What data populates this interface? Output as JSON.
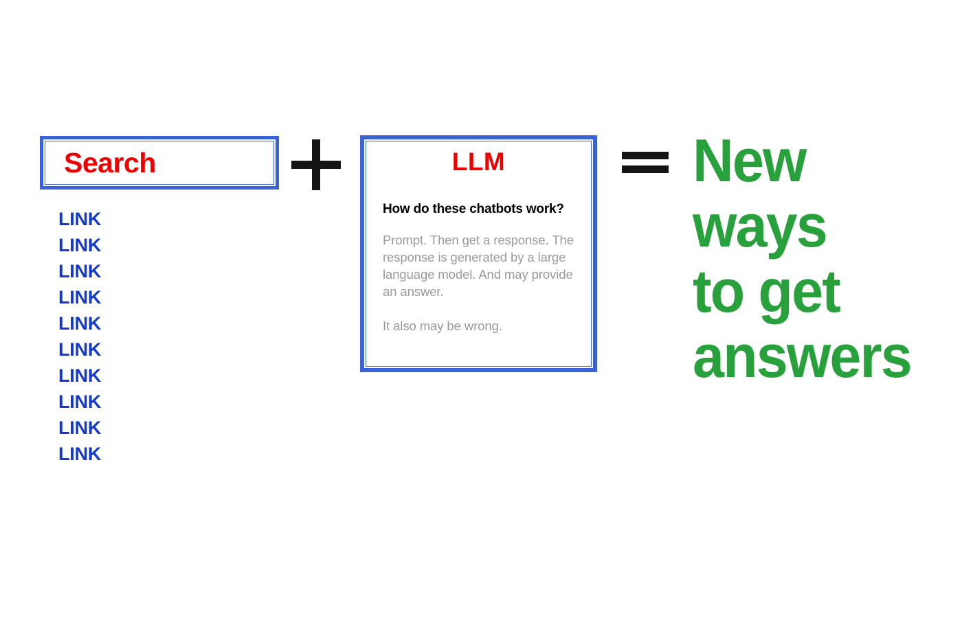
{
  "equation": {
    "plus_symbol": "+",
    "equals_symbol": "="
  },
  "search_panel": {
    "box_label": "Search",
    "links": [
      {
        "label": "LINK"
      },
      {
        "label": "LINK"
      },
      {
        "label": "LINK"
      },
      {
        "label": "LINK"
      },
      {
        "label": "LINK"
      },
      {
        "label": "LINK"
      },
      {
        "label": "LINK"
      },
      {
        "label": "LINK"
      },
      {
        "label": "LINK"
      },
      {
        "label": "LINK"
      }
    ]
  },
  "llm_panel": {
    "title": "LLM",
    "heading": "How do these chatbots work?",
    "paragraph": "Prompt. Then get a response. The response is generated by a large language model. And may provide an answer.",
    "footnote": "It also may be wrong."
  },
  "outcome": {
    "lines": [
      "New",
      "ways",
      "to get",
      "answers"
    ],
    "full_text": "New ways to get answers"
  },
  "colors": {
    "accent_blue": "#3a62d8",
    "link_blue": "#1338cf",
    "title_red": "#ee0000",
    "body_gray": "#9a9a9a",
    "outcome_green": "#28a03c",
    "symbol_black": "#141414",
    "background": "#ffffff"
  }
}
